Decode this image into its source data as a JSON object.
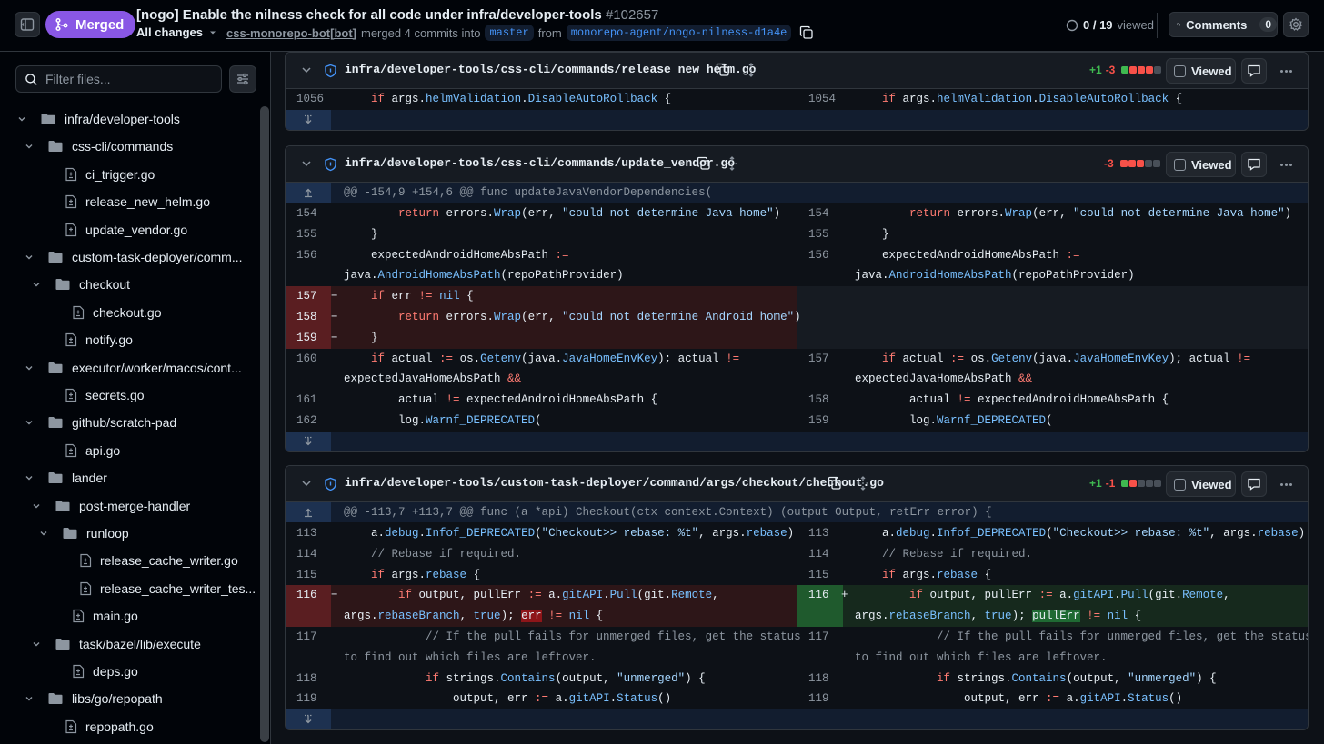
{
  "header": {
    "status_label": "Merged",
    "title": "[nogo] Enable the nilness check for all code under infra/developer-tools",
    "number": "#102657",
    "all_changes_label": "All changes",
    "author": "css-monorepo-bot[bot]",
    "merge_text": "merged 4 commits into",
    "base_branch": "master",
    "from_text": "from",
    "head_branch": "monorepo-agent/nogo-nilness-d1a4e",
    "viewed_count": "0 / 19",
    "viewed_label": "viewed",
    "comments_label": "Comments",
    "comments_count": "0",
    "accent": "#8957e5"
  },
  "sidebar": {
    "filter_placeholder": "Filter files...",
    "tree": [
      {
        "type": "dir",
        "label": "infra/developer-tools",
        "depth": 0
      },
      {
        "type": "dir",
        "label": "css-cli/commands",
        "depth": 1
      },
      {
        "type": "file",
        "label": "ci_trigger.go",
        "depth": 2
      },
      {
        "type": "file",
        "label": "release_new_helm.go",
        "depth": 2
      },
      {
        "type": "file",
        "label": "update_vendor.go",
        "depth": 2
      },
      {
        "type": "dir",
        "label": "custom-task-deployer/comm...",
        "depth": 1
      },
      {
        "type": "dir",
        "label": "checkout",
        "depth": 2
      },
      {
        "type": "file",
        "label": "checkout.go",
        "depth": 3
      },
      {
        "type": "file",
        "label": "notify.go",
        "depth": 2
      },
      {
        "type": "dir",
        "label": "executor/worker/macos/cont...",
        "depth": 1
      },
      {
        "type": "file",
        "label": "secrets.go",
        "depth": 2
      },
      {
        "type": "dir",
        "label": "github/scratch-pad",
        "depth": 1
      },
      {
        "type": "file",
        "label": "api.go",
        "depth": 2
      },
      {
        "type": "dir",
        "label": "lander",
        "depth": 1
      },
      {
        "type": "dir",
        "label": "post-merge-handler",
        "depth": 2
      },
      {
        "type": "dir",
        "label": "runloop",
        "depth": 3
      },
      {
        "type": "file",
        "label": "release_cache_writer.go",
        "depth": 4
      },
      {
        "type": "file",
        "label": "release_cache_writer_tes...",
        "depth": 4
      },
      {
        "type": "file",
        "label": "main.go",
        "depth": 3
      },
      {
        "type": "dir",
        "label": "task/bazel/lib/execute",
        "depth": 2
      },
      {
        "type": "file",
        "label": "deps.go",
        "depth": 3
      },
      {
        "type": "dir",
        "label": "libs/go/repopath",
        "depth": 1
      },
      {
        "type": "file",
        "label": "repopath.go",
        "depth": 2
      }
    ]
  },
  "files": [
    {
      "path": "infra/developer-tools/css-cli/commands/release_new_helm.go",
      "add": "+1",
      "del": "-3",
      "blocks": [
        "add",
        "del",
        "del",
        "del",
        "none"
      ],
      "viewed_label": "Viewed",
      "rows": [
        {
          "kind": "ctx",
          "l_num": "1056",
          "r_num": "1054",
          "l_html": "    <span class=\"kw\">if</span> args.<span class=\"fn\">helmValidation</span>.<span class=\"fn\">DisableAutoRollback</span> {",
          "r_html": "    <span class=\"kw\">if</span> args.<span class=\"fn\">helmValidation</span>.<span class=\"fn\">DisableAutoRollback</span> {"
        }
      ]
    },
    {
      "path": "infra/developer-tools/css-cli/commands/update_vendor.go",
      "add": "",
      "del": "-3",
      "blocks": [
        "del",
        "del",
        "del",
        "none",
        "none"
      ],
      "viewed_label": "Viewed",
      "hunk": "@@ -154,9 +154,6 @@ func updateJavaVendorDependencies(",
      "rows": [
        {
          "kind": "ctx",
          "l_num": "154",
          "r_num": "154",
          "l_html": "        <span class=\"kw\">return</span> errors.<span class=\"fn\">Wrap</span>(err, <span class=\"st\">\"could not determine Java home\"</span>)",
          "r_html": "        <span class=\"kw\">return</span> errors.<span class=\"fn\">Wrap</span>(err, <span class=\"st\">\"could not determine Java home\"</span>)"
        },
        {
          "kind": "ctx",
          "l_num": "155",
          "r_num": "155",
          "l_html": "    }",
          "r_html": "    }"
        },
        {
          "kind": "ctx2",
          "l_num": "156",
          "r_num": "156",
          "l_html": "    expectedAndroidHomeAbsPath <span class=\"op\">:=</span>",
          "r_html": "    expectedAndroidHomeAbsPath <span class=\"op\">:=</span>",
          "l_html2": "java.<span class=\"fn\">AndroidHomeAbsPath</span>(repoPathProvider)",
          "r_html2": "java.<span class=\"fn\">AndroidHomeAbsPath</span>(repoPathProvider)"
        },
        {
          "kind": "del",
          "l_num": "157",
          "l_html": "    <span class=\"kw\">if</span> err <span class=\"op\">!=</span> <span class=\"fn\">nil</span> {"
        },
        {
          "kind": "del",
          "l_num": "158",
          "l_html": "        <span class=\"kw\">return</span> errors.<span class=\"fn\">Wrap</span>(err, <span class=\"st\">\"could not determine Android home\"</span>)"
        },
        {
          "kind": "del",
          "l_num": "159",
          "l_html": "    }"
        },
        {
          "kind": "ctx2",
          "l_num": "160",
          "r_num": "157",
          "l_html": "    <span class=\"kw\">if</span> actual <span class=\"op\">:=</span> os.<span class=\"fn\">Getenv</span>(java.<span class=\"fn\">JavaHomeEnvKey</span>); actual <span class=\"op\">!=</span>",
          "r_html": "    <span class=\"kw\">if</span> actual <span class=\"op\">:=</span> os.<span class=\"fn\">Getenv</span>(java.<span class=\"fn\">JavaHomeEnvKey</span>); actual <span class=\"op\">!=</span>",
          "l_html2": "expectedJavaHomeAbsPath <span class=\"op\">&amp;&amp;</span>",
          "r_html2": "expectedJavaHomeAbsPath <span class=\"op\">&amp;&amp;</span>"
        },
        {
          "kind": "ctx",
          "l_num": "161",
          "r_num": "158",
          "l_html": "        actual <span class=\"op\">!=</span> expectedAndroidHomeAbsPath {",
          "r_html": "        actual <span class=\"op\">!=</span> expectedAndroidHomeAbsPath {"
        },
        {
          "kind": "ctx",
          "l_num": "162",
          "r_num": "159",
          "l_html": "        log.<span class=\"fn\">Warnf_DEPRECATED</span>(",
          "r_html": "        log.<span class=\"fn\">Warnf_DEPRECATED</span>("
        }
      ]
    },
    {
      "path": "infra/developer-tools/custom-task-deployer/command/args/checkout/checkout.go",
      "add": "+1",
      "del": "-1",
      "blocks": [
        "add",
        "del",
        "none",
        "none",
        "none"
      ],
      "viewed_label": "Viewed",
      "hunk": "@@ -113,7 +113,7 @@ func (a *api) Checkout(ctx context.Context) (output Output, retErr error) {",
      "rows": [
        {
          "kind": "ctx",
          "l_num": "113",
          "r_num": "113",
          "l_html": "    a.<span class=\"fn\">debug</span>.<span class=\"fn\">Infof_DEPRECATED</span>(<span class=\"st\">\"Checkout&gt;&gt; rebase: %t\"</span>, args.<span class=\"fn\">rebase</span>)",
          "r_html": "    a.<span class=\"fn\">debug</span>.<span class=\"fn\">Infof_DEPRECATED</span>(<span class=\"st\">\"Checkout&gt;&gt; rebase: %t\"</span>, args.<span class=\"fn\">rebase</span>)"
        },
        {
          "kind": "ctx",
          "l_num": "114",
          "r_num": "114",
          "l_html": "    <span class=\"cm\">// Rebase if required.</span>",
          "r_html": "    <span class=\"cm\">// Rebase if required.</span>"
        },
        {
          "kind": "ctx",
          "l_num": "115",
          "r_num": "115",
          "l_html": "    <span class=\"kw\">if</span> args.<span class=\"fn\">rebase</span> {",
          "r_html": "    <span class=\"kw\">if</span> args.<span class=\"fn\">rebase</span> {"
        },
        {
          "kind": "change2",
          "l_num": "116",
          "r_num": "116",
          "l_html": "        <span class=\"kw\">if</span> output, pullErr <span class=\"op\">:=</span> a.<span class=\"fn\">gitAPI</span>.<span class=\"fn\">Pull</span>(git.<span class=\"fn\">Remote</span>,",
          "r_html": "        <span class=\"kw\">if</span> output, pullErr <span class=\"op\">:=</span> a.<span class=\"fn\">gitAPI</span>.<span class=\"fn\">Pull</span>(git.<span class=\"fn\">Remote</span>,",
          "l_html2": "args.<span class=\"fn\">rebaseBranch</span>, <span class=\"fn\">true</span>); <span class=\"hl-del\">err</span> <span class=\"op\">!=</span> <span class=\"fn\">nil</span> {",
          "r_html2": "args.<span class=\"fn\">rebaseBranch</span>, <span class=\"fn\">true</span>); <span class=\"hl-add\">pullErr</span> <span class=\"op\">!=</span> <span class=\"fn\">nil</span> {"
        },
        {
          "kind": "ctx2",
          "l_num": "117",
          "r_num": "117",
          "l_html": "            <span class=\"cm\">// If the pull fails for unmerged files, get the status</span>",
          "r_html": "            <span class=\"cm\">// If the pull fails for unmerged files, get the status</span>",
          "l_html2": "<span class=\"cm\">to find out which files are leftover.</span>",
          "r_html2": "<span class=\"cm\">to find out which files are leftover.</span>"
        },
        {
          "kind": "ctx",
          "l_num": "118",
          "r_num": "118",
          "l_html": "            <span class=\"kw\">if</span> strings.<span class=\"fn\">Contains</span>(output, <span class=\"st\">\"unmerged\"</span>) {",
          "r_html": "            <span class=\"kw\">if</span> strings.<span class=\"fn\">Contains</span>(output, <span class=\"st\">\"unmerged\"</span>) {"
        },
        {
          "kind": "ctx",
          "l_num": "119",
          "r_num": "119",
          "l_html": "                output, err <span class=\"op\">:=</span> a.<span class=\"fn\">gitAPI</span>.<span class=\"fn\">Status</span>()",
          "r_html": "                output, err <span class=\"op\">:=</span> a.<span class=\"fn\">gitAPI</span>.<span class=\"fn\">Status</span>()"
        }
      ]
    }
  ]
}
